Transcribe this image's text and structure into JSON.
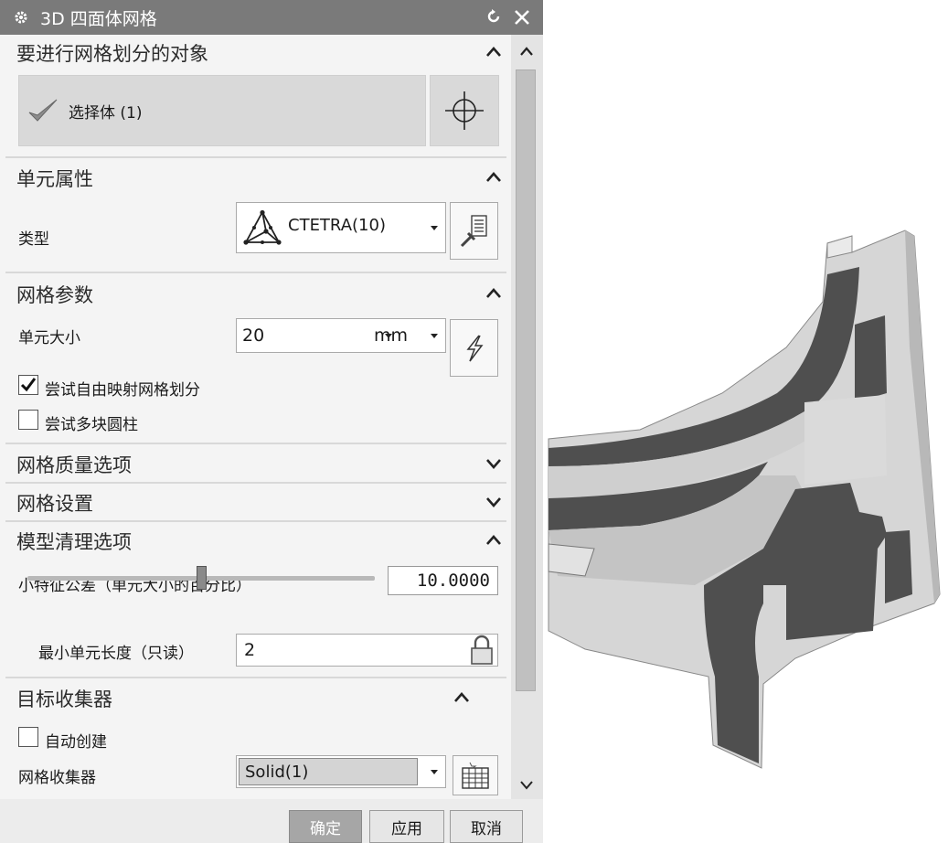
{
  "dialog": {
    "title": "3D 四面体网格",
    "icons": {
      "title": "gear-icon",
      "reset": "reset-icon",
      "close": "close-icon"
    }
  },
  "sections": {
    "objects": {
      "header": "要进行网格划分的对象",
      "select_label": "选择体 (1)"
    },
    "element_props": {
      "header": "单元属性",
      "type_label": "类型",
      "type_value": "CTETRA(10)"
    },
    "mesh_params": {
      "header": "网格参数",
      "size_label": "单元大小",
      "size_value": "20",
      "size_unit": "mm",
      "free_map_label": "尝试自由映射网格划分",
      "free_map_checked": true,
      "multi_cyl_label": "尝试多块圆柱",
      "multi_cyl_checked": false
    },
    "quality": {
      "header": "网格质量选项"
    },
    "settings": {
      "header": "网格设置"
    },
    "cleanup": {
      "header": "模型清理选项",
      "tolerance_label": "小特征公差（单元大小的百分比）",
      "tolerance_value": "10.0000",
      "tolerance_fraction": 0.5,
      "min_len_label": "最小单元长度（只读）",
      "min_len_value": "2"
    },
    "collector": {
      "header": "目标收集器",
      "auto_create_label": "自动创建",
      "auto_create_checked": false,
      "collector_label": "网格收集器",
      "collector_value": "Solid(1)"
    }
  },
  "buttons": {
    "ok": "确定",
    "apply": "应用",
    "cancel": "取消"
  },
  "colors": {
    "titlebar": "#7a7a7a",
    "panel": "#f4f4f4",
    "model_dark": "#4f4f4f",
    "model_light": "#cfcfcf"
  }
}
